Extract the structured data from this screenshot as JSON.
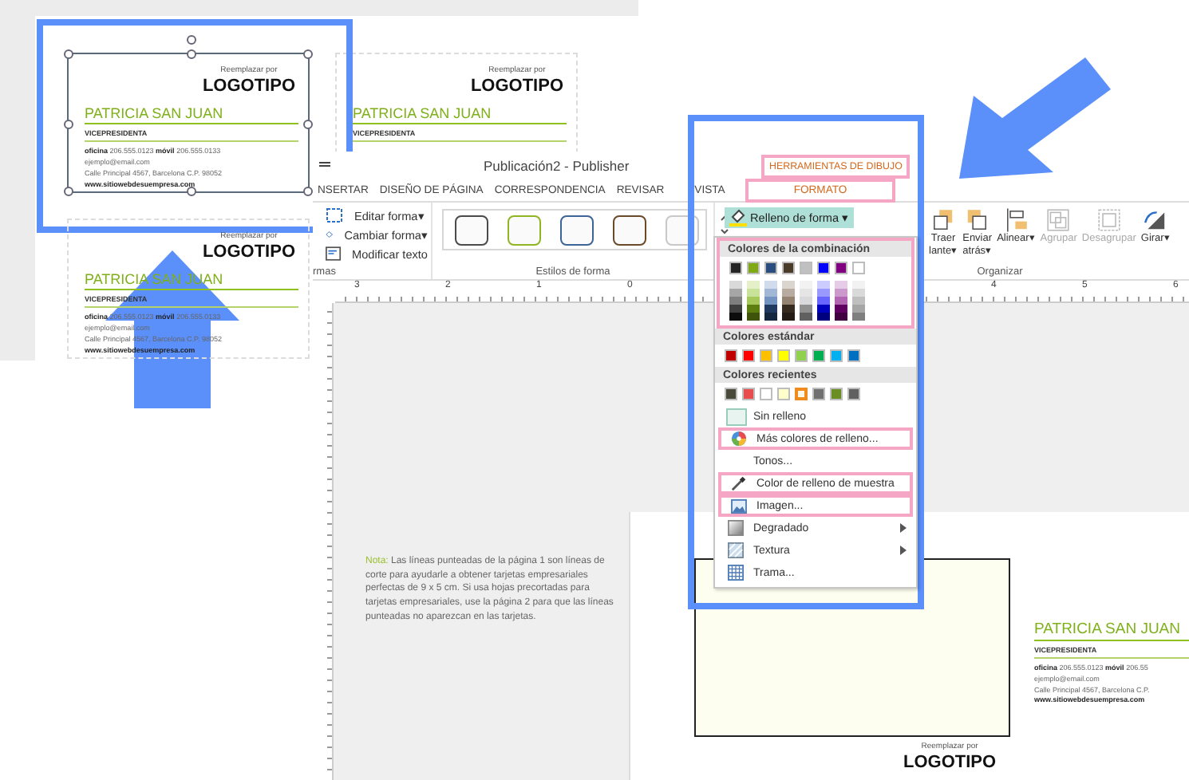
{
  "background": {
    "cards": [
      {
        "selected": true,
        "logo_caption": "Reemplazar por",
        "logo": "LOGOTIPO",
        "name": "PATRICIA SAN JUAN",
        "title": "VICEPRESIDENTA",
        "contact": [
          "**oficina** 206.555.0123  **móvil** 206.555.0133",
          "ejemplo@email.com",
          "Calle Principal 4567, Barcelona C.P. 98052",
          "**www.sitiowebdesuempresa.com**"
        ]
      },
      {
        "selected": false,
        "logo_caption": "Reemplazar por",
        "logo": "LOGOTIPO",
        "name": "PATRICIA SAN JUAN",
        "title": "VICEPRESIDENTA"
      },
      {
        "selected": false,
        "logo_caption": "Reemplazar por",
        "logo": "LOGOTIPO",
        "name": "PATRICIA SAN JUAN",
        "title": "VICEPRESIDENTA",
        "contact": [
          "**oficina** 206.555.0123  **móvil** 206.555.0133",
          "ejemplo@email.com",
          "Calle Principal 4567, Barcelona C.P. 98052",
          "**www.sitiowebdesuempresa.com**"
        ]
      }
    ]
  },
  "window": {
    "title": "Publicación2 - Publisher",
    "contextual_tab_group": {
      "label": "HERRAMIENTAS DE DIBUJO",
      "highlighted": true
    }
  },
  "tabs": [
    {
      "label": "NSERTAR",
      "selected": false,
      "highlighted": false
    },
    {
      "label": "DISEÑO DE PÁGINA",
      "selected": false,
      "highlighted": false
    },
    {
      "label": "CORRESPONDENCIA",
      "selected": false,
      "highlighted": false
    },
    {
      "label": "REVISAR",
      "selected": false,
      "highlighted": false
    },
    {
      "label": "VISTA",
      "selected": false,
      "highlighted": false
    },
    {
      "label": "FORMATO",
      "selected": true,
      "highlighted": true
    }
  ],
  "ribbon": {
    "groups": [
      {
        "label": "rmas"
      },
      {
        "label": "Estilos de forma"
      },
      {
        "label": "Organizar"
      }
    ],
    "shape_commands": [
      {
        "label": "Editar forma",
        "dropdown": "▾"
      },
      {
        "label": "Cambiar forma",
        "dropdown": "▾"
      },
      {
        "label": "Modificar texto"
      }
    ],
    "shape_styles": [
      {
        "color": "#4a4a4a"
      },
      {
        "color": "#8fb520"
      },
      {
        "color": "#3d6496"
      },
      {
        "color": "#6b4a2a"
      },
      {
        "color": "#c8c8c8"
      }
    ],
    "fill_button": {
      "label": "Relleno de forma",
      "dropdown": "▾",
      "expanded": true
    },
    "arrange": [
      {
        "lines": [
          "Traer",
          "lante"
        ],
        "dropdown": "▾",
        "disabled": false
      },
      {
        "lines": [
          "Enviar",
          "atrás"
        ],
        "dropdown": "▾",
        "disabled": false
      },
      {
        "lines": [
          "Alinear"
        ],
        "dropdown": "▾",
        "disabled": false
      },
      {
        "lines": [
          "Agrupar"
        ],
        "disabled": true
      },
      {
        "lines": [
          "Desagrupar"
        ],
        "disabled": true
      },
      {
        "lines": [
          "Girar"
        ],
        "dropdown": "▾",
        "disabled": false
      }
    ]
  },
  "ruler": {
    "labels": [
      "3",
      "2",
      "1",
      "0",
      "4",
      "5",
      "6"
    ]
  },
  "note": {
    "label": "Nota:",
    "text": "Las líneas punteadas de la página 1 son líneas de corte para ayudarle a obtener tarjetas empresariales perfectas de 9 x 5 cm. Si usa hojas precortadas para tarjetas empresariales, use la página 2 para que las líneas punteadas no aparezcan en las tarjetas."
  },
  "page_card": {
    "logo_caption": "Reemplazar por",
    "logo": "LOGOTIPO",
    "name": "PATRICIA SAN JUAN",
    "title": "VICEPRESIDENTA",
    "contact": [
      "**oficina** 206.555.0123  **móvil** 206.55",
      "ejemplo@email.com",
      "Calle Principal 4567, Barcelona C.P.",
      "**www.sitiowebdesuempresa.com**"
    ]
  },
  "menu": {
    "scheme": {
      "label": "Colores de la combinación",
      "highlighted": true,
      "rows": [
        [
          {
            "color": "#262626"
          },
          {
            "color": "#7fa815"
          },
          {
            "color": "#2b4c7e"
          },
          {
            "color": "#4a3a2a"
          },
          {
            "color": "#c0c0c0"
          },
          {
            "color": "#0000ff"
          },
          {
            "color": "#800080"
          },
          {
            "color": "#ffffff"
          }
        ],
        [
          {
            "color": "#d9d9d9"
          },
          {
            "color": "#e5f0c8"
          },
          {
            "color": "#d0dbeb"
          },
          {
            "color": "#dbd5cf"
          },
          {
            "color": "#f2f2f2"
          },
          {
            "color": "#ccccff"
          },
          {
            "color": "#e6cce6"
          },
          {
            "color": "#f2f2f3"
          }
        ],
        [
          {
            "color": "#a6a6a6"
          },
          {
            "color": "#c9e29a"
          },
          {
            "color": "#a1b7d6"
          },
          {
            "color": "#b8aca0"
          },
          {
            "color": "#e5e5e5"
          },
          {
            "color": "#9999ff"
          },
          {
            "color": "#cc99cc"
          },
          {
            "color": "#d9d9da"
          }
        ],
        [
          {
            "color": "#7f7f7f"
          },
          {
            "color": "#a6c85a"
          },
          {
            "color": "#7393c1"
          },
          {
            "color": "#958371"
          },
          {
            "color": "#d9d9db"
          },
          {
            "color": "#6666ff"
          },
          {
            "color": "#b266b2"
          },
          {
            "color": "#bfbfbf"
          }
        ],
        [
          {
            "color": "#3f3f3f"
          },
          {
            "color": "#5f7e10"
          },
          {
            "color": "#20395e"
          },
          {
            "color": "#372b1f"
          },
          {
            "color": "#909090"
          },
          {
            "color": "#0000bf"
          },
          {
            "color": "#600060"
          },
          {
            "color": "#a6a6a7"
          }
        ],
        [
          {
            "color": "#0d0d0d"
          },
          {
            "color": "#3f540a"
          },
          {
            "color": "#15263f"
          },
          {
            "color": "#251d15"
          },
          {
            "color": "#606060"
          },
          {
            "color": "#00007f"
          },
          {
            "color": "#400040"
          },
          {
            "color": "#7f7f80"
          }
        ]
      ]
    },
    "standard": {
      "label": "Colores estándar",
      "swatches": [
        {
          "color": "#c00000"
        },
        {
          "color": "#ff0000"
        },
        {
          "color": "#ffc000"
        },
        {
          "color": "#ffff00"
        },
        {
          "color": "#92d050"
        },
        {
          "color": "#00b050"
        },
        {
          "color": "#00b0f0"
        },
        {
          "color": "#0070c0"
        }
      ]
    },
    "recent": {
      "label": "Colores recientes",
      "swatches": [
        {
          "color": "#4a4a3a",
          "selected": false
        },
        {
          "color": "#e84c4c",
          "selected": false
        },
        {
          "color": "#ffffff",
          "selected": false
        },
        {
          "color": "#ffffcc",
          "selected": false
        },
        {
          "color": "#fff8e8",
          "selected": true
        },
        {
          "color": "#707070",
          "selected": false
        },
        {
          "color": "#6b8e23",
          "selected": false
        },
        {
          "color": "#606061",
          "selected": false
        }
      ]
    },
    "items": [
      {
        "label": "Sin relleno",
        "submenu": false,
        "highlighted": false
      },
      {
        "label": "Más colores de relleno...",
        "submenu": false,
        "highlighted": true
      },
      {
        "label": "Tonos...",
        "submenu": false,
        "highlighted": false
      },
      {
        "label": "Color de relleno de muestra",
        "submenu": false,
        "highlighted": true
      },
      {
        "label": "Imagen...",
        "submenu": false,
        "highlighted": true
      },
      {
        "label": "Degradado",
        "submenu": true,
        "highlighted": false
      },
      {
        "label": "Textura",
        "submenu": true,
        "highlighted": false
      },
      {
        "label": "Trama...",
        "submenu": false,
        "highlighted": false
      }
    ]
  }
}
